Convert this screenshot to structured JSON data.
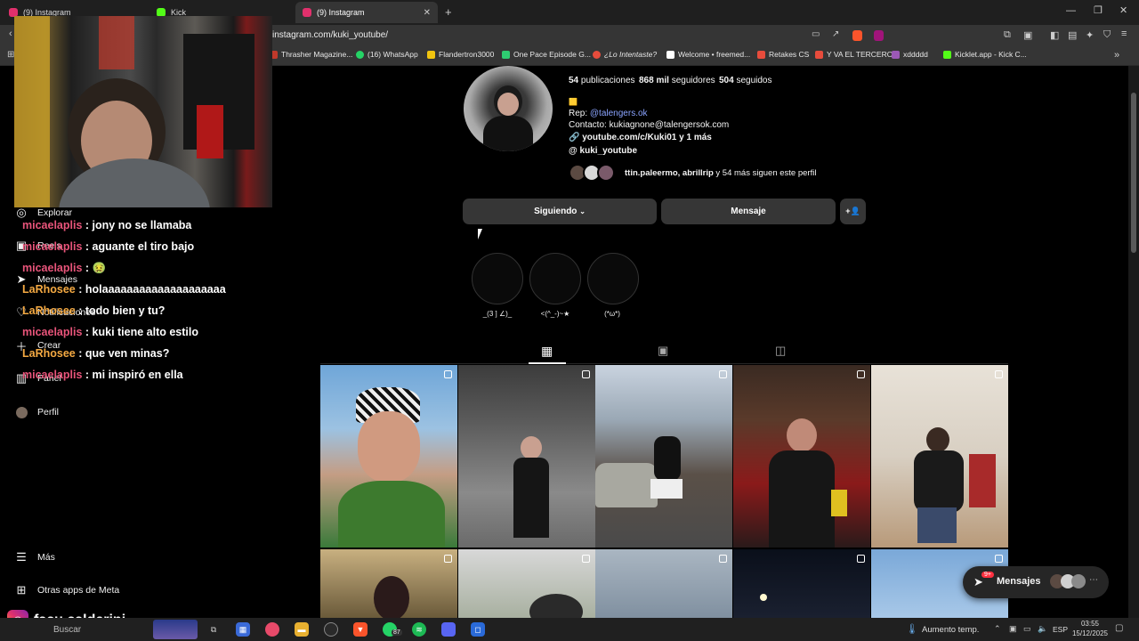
{
  "browser": {
    "tabs": [
      {
        "label": "(9) Instagram",
        "color": "#e1306c"
      },
      {
        "label": "Kick",
        "color": "#53fc18"
      },
      {
        "label": "(9) Instagram",
        "color": "#e1306c"
      }
    ],
    "url": "instagram.com/kuki_youtube/",
    "bookmarks": [
      {
        "label": "Thrasher Magazine...",
        "color": "#c0392b"
      },
      {
        "label": "(16) WhatsApp",
        "color": "#25d366"
      },
      {
        "label": "Flandertron3000",
        "color": "#f1c40f"
      },
      {
        "label": "One Pace Episode G...",
        "color": "#2ecc71"
      },
      {
        "label": "¿Lo Intentaste?",
        "color": "#e74c3c"
      },
      {
        "label": "Welcome • freemed...",
        "color": "#ffffff"
      },
      {
        "label": "Retakes CS",
        "color": "#e74c3c"
      },
      {
        "label": "Y VA EL TERCERO",
        "color": "#e74c3c"
      },
      {
        "label": "xddddd",
        "color": "#9b59b6"
      },
      {
        "label": "Kicklet.app - Kick C...",
        "color": "#53fc18"
      }
    ]
  },
  "sidebar": {
    "items": [
      {
        "label": "Explorar",
        "icon": "compass-icon"
      },
      {
        "label": "Reels",
        "icon": "reels-icon"
      },
      {
        "label": "Mensajes",
        "icon": "messages-icon"
      },
      {
        "label": "Notificaciones",
        "icon": "heart-icon"
      },
      {
        "label": "Crear",
        "icon": "plus-icon"
      },
      {
        "label": "Panel",
        "icon": "panel-icon"
      },
      {
        "label": "Perfil",
        "icon": "avatar-icon"
      }
    ],
    "more_label": "Más",
    "meta_label": "Otras apps de Meta"
  },
  "chat": [
    {
      "user": "micaelaplis",
      "text": ": jony no se llamaba",
      "color": "#e8547a"
    },
    {
      "user": "micaelaplis",
      "text": ": aguante el tiro bajo",
      "color": "#e8547a"
    },
    {
      "user": "micaelaplis",
      "text": ": 🤢",
      "color": "#e8547a"
    },
    {
      "user": "LaRhosee",
      "text": ": holaaaaaaaaaaaaaaaaaaaa",
      "color": "#f4a942"
    },
    {
      "user": "LaRhosee",
      "text": ": todo bien y tu?",
      "color": "#f4a942"
    },
    {
      "user": "micaelaplis",
      "text": ": kuki tiene alto estilo",
      "color": "#e8547a"
    },
    {
      "user": "LaRhosee",
      "text": ": que ven minas?",
      "color": "#f4a942"
    },
    {
      "user": "micaelaplis",
      "text": ": mi inspiró en ella",
      "color": "#e8547a"
    }
  ],
  "streamer": {
    "name": "facu.calderini"
  },
  "profile": {
    "stats": {
      "posts_num": "54",
      "posts_label": "publicaciones",
      "followers_num": "868 mil",
      "followers_label": "seguidores",
      "following_num": "504",
      "following_label": "seguidos"
    },
    "bio_emoji": "🟨",
    "rep_prefix": "Rep: ",
    "rep_handle": "@talengers.ok",
    "contact": "Contacto: kukiagnone@talengersok.com",
    "link": "youtube.com/c/Kuki01 y 1 más",
    "threads": "kuki_youtube",
    "followed_by_names": "ttin.paleermo, abrillrip",
    "followed_by_rest": " y 54 más siguen este perfil",
    "following_button": "Siguiendo",
    "message_button": "Mensaje",
    "highlights": [
      {
        "label": "_(3 ] ∠)_"
      },
      {
        "label": "<(^_-)~★"
      },
      {
        "label": "(*ω*)"
      }
    ]
  },
  "messages_pill": {
    "label": "Mensajes",
    "badge": "9+"
  },
  "taskbar": {
    "search": "Buscar",
    "weather": "Aumento temp.",
    "lang": "ESP",
    "time": "03:55",
    "date": "15/12/2025",
    "whatsapp_badge": "87"
  }
}
